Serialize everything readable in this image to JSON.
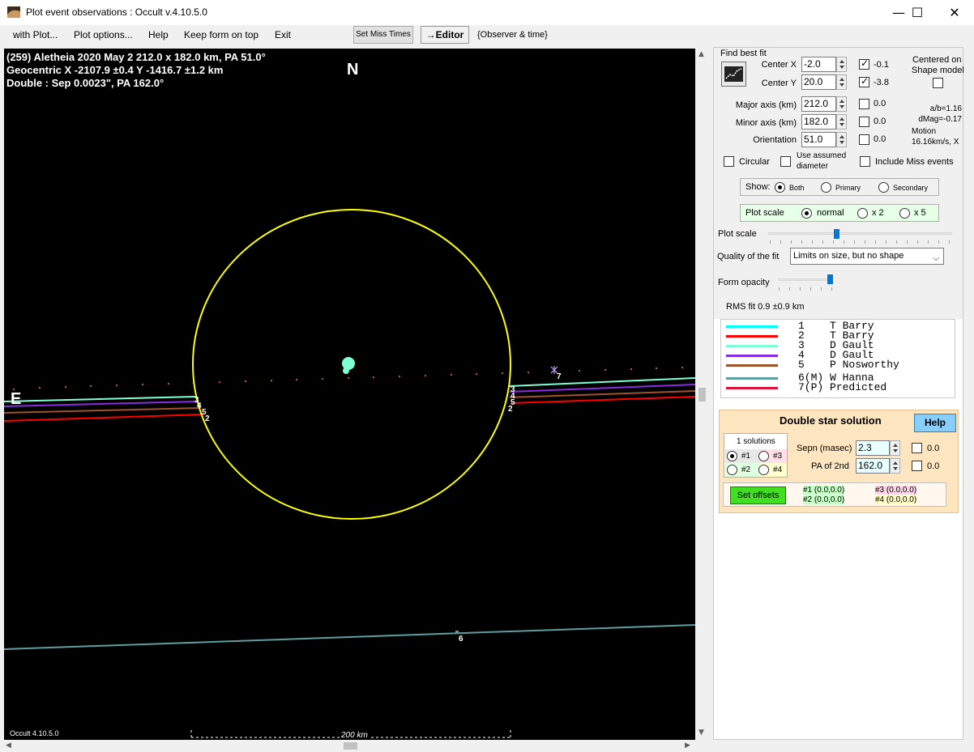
{
  "window": {
    "title": "Plot event observations : Occult v.4.10.5.0",
    "minimize": "—",
    "maximize": "☐",
    "close": "✕"
  },
  "menu": {
    "with_plot": "with Plot...",
    "plot_options": "Plot options...",
    "help": "Help",
    "keep_on_top": "Keep form on top",
    "exit": "Exit",
    "set_miss_times": "Set Miss Times",
    "editor": "→Editor",
    "observer_time": "{Observer & time}"
  },
  "plot": {
    "info_line1": "(259) Aletheia  2020 May 2  212.0 x 182.0 km, PA 51.0°",
    "info_line2": "Geocentric  X  -2107.9 ±0.4  Y -1416.7 ±1.2 km",
    "info_line3": "Double : Sep  0.0023\", PA 162.0°",
    "north": "N",
    "east": "E",
    "version": "Occult 4.10.5.0",
    "scale_label": "200 km",
    "chord_labels": {
      "left": [
        "3",
        "4",
        "5",
        "2"
      ],
      "right": [
        "3",
        "4",
        "5",
        "2"
      ],
      "predicted": "7",
      "hanna": "6"
    },
    "ellipse_color": "#ffff00"
  },
  "panel": {
    "find_best_fit": "Find best fit",
    "center_x_label": "Center X",
    "center_x": "-2.0",
    "center_x_check": true,
    "center_x_sd": "-0.1",
    "center_y_label": "Center Y",
    "center_y": "20.0",
    "center_y_check": true,
    "center_y_sd": "-3.8",
    "centered_on": "Centered on",
    "shape_model": "Shape model",
    "major_label": "Major axis (km)",
    "major": "212.0",
    "major_sd": "0.0",
    "minor_label": "Minor axis (km)",
    "minor": "182.0",
    "minor_sd": "0.0",
    "orient_label": "Orientation",
    "orient": "51.0",
    "orient_sd": "0.0",
    "ab_ratio": "a/b=1.16",
    "dmag": "dMag=-0.17",
    "motion_label": "Motion",
    "motion": "16.16km/s, X",
    "circular": "Circular",
    "use_assumed_1": "Use assumed",
    "use_assumed_2": "diameter",
    "include_miss": "Include Miss events",
    "show_label": "Show:",
    "show_both": "Both",
    "show_primary": "Primary",
    "show_secondary": "Secondary",
    "plot_scale_box": "Plot scale",
    "scale_normal": "normal",
    "scale_x2": "x 2",
    "scale_x5": "x 5",
    "plot_scale_label": "Plot scale",
    "plot_scale_level": 0.37,
    "quality_label": "Quality of the fit",
    "quality_value": "Limits on size, but no shape",
    "opacity_label": "Form opacity",
    "opacity_level": 1.0,
    "rms_fit": "RMS fit 0.9 ±0.9 km"
  },
  "legend": [
    {
      "num": "1",
      "name": "T Barry",
      "color": "#00ffff"
    },
    {
      "num": "2",
      "name": "T Barry",
      "color": "#ff0000"
    },
    {
      "num": "3",
      "name": "D Gault",
      "color": "#7fffd4"
    },
    {
      "num": "4",
      "name": "D Gault",
      "color": "#8a2be2"
    },
    {
      "num": "5",
      "name": "P Nosworthy",
      "color": "#a0522d"
    },
    {
      "num": "6(M)",
      "name": "W Hanna",
      "color": "#5f9ea0"
    },
    {
      "num": "7(P)",
      "name": "Predicted",
      "color": "#dc143c"
    }
  ],
  "double_star": {
    "title": "Double star solution",
    "help": "Help",
    "solutions": "1 solutions",
    "s1": "#1",
    "s2": "#2",
    "s3": "#3",
    "s4": "#4",
    "sepn_label": "Sepn (masec)",
    "sepn": "2.3",
    "sepn_sd": "0.0",
    "pa_label": "PA of 2nd",
    "pa": "162.0",
    "pa_sd": "0.0",
    "set_offsets": "Set offsets",
    "off1": "#1 (0.0,0.0)",
    "off2": "#2 (0.0,0.0)",
    "off3": "#3 (0.0,0.0)",
    "off4": "#4 (0.0,0.0)"
  }
}
